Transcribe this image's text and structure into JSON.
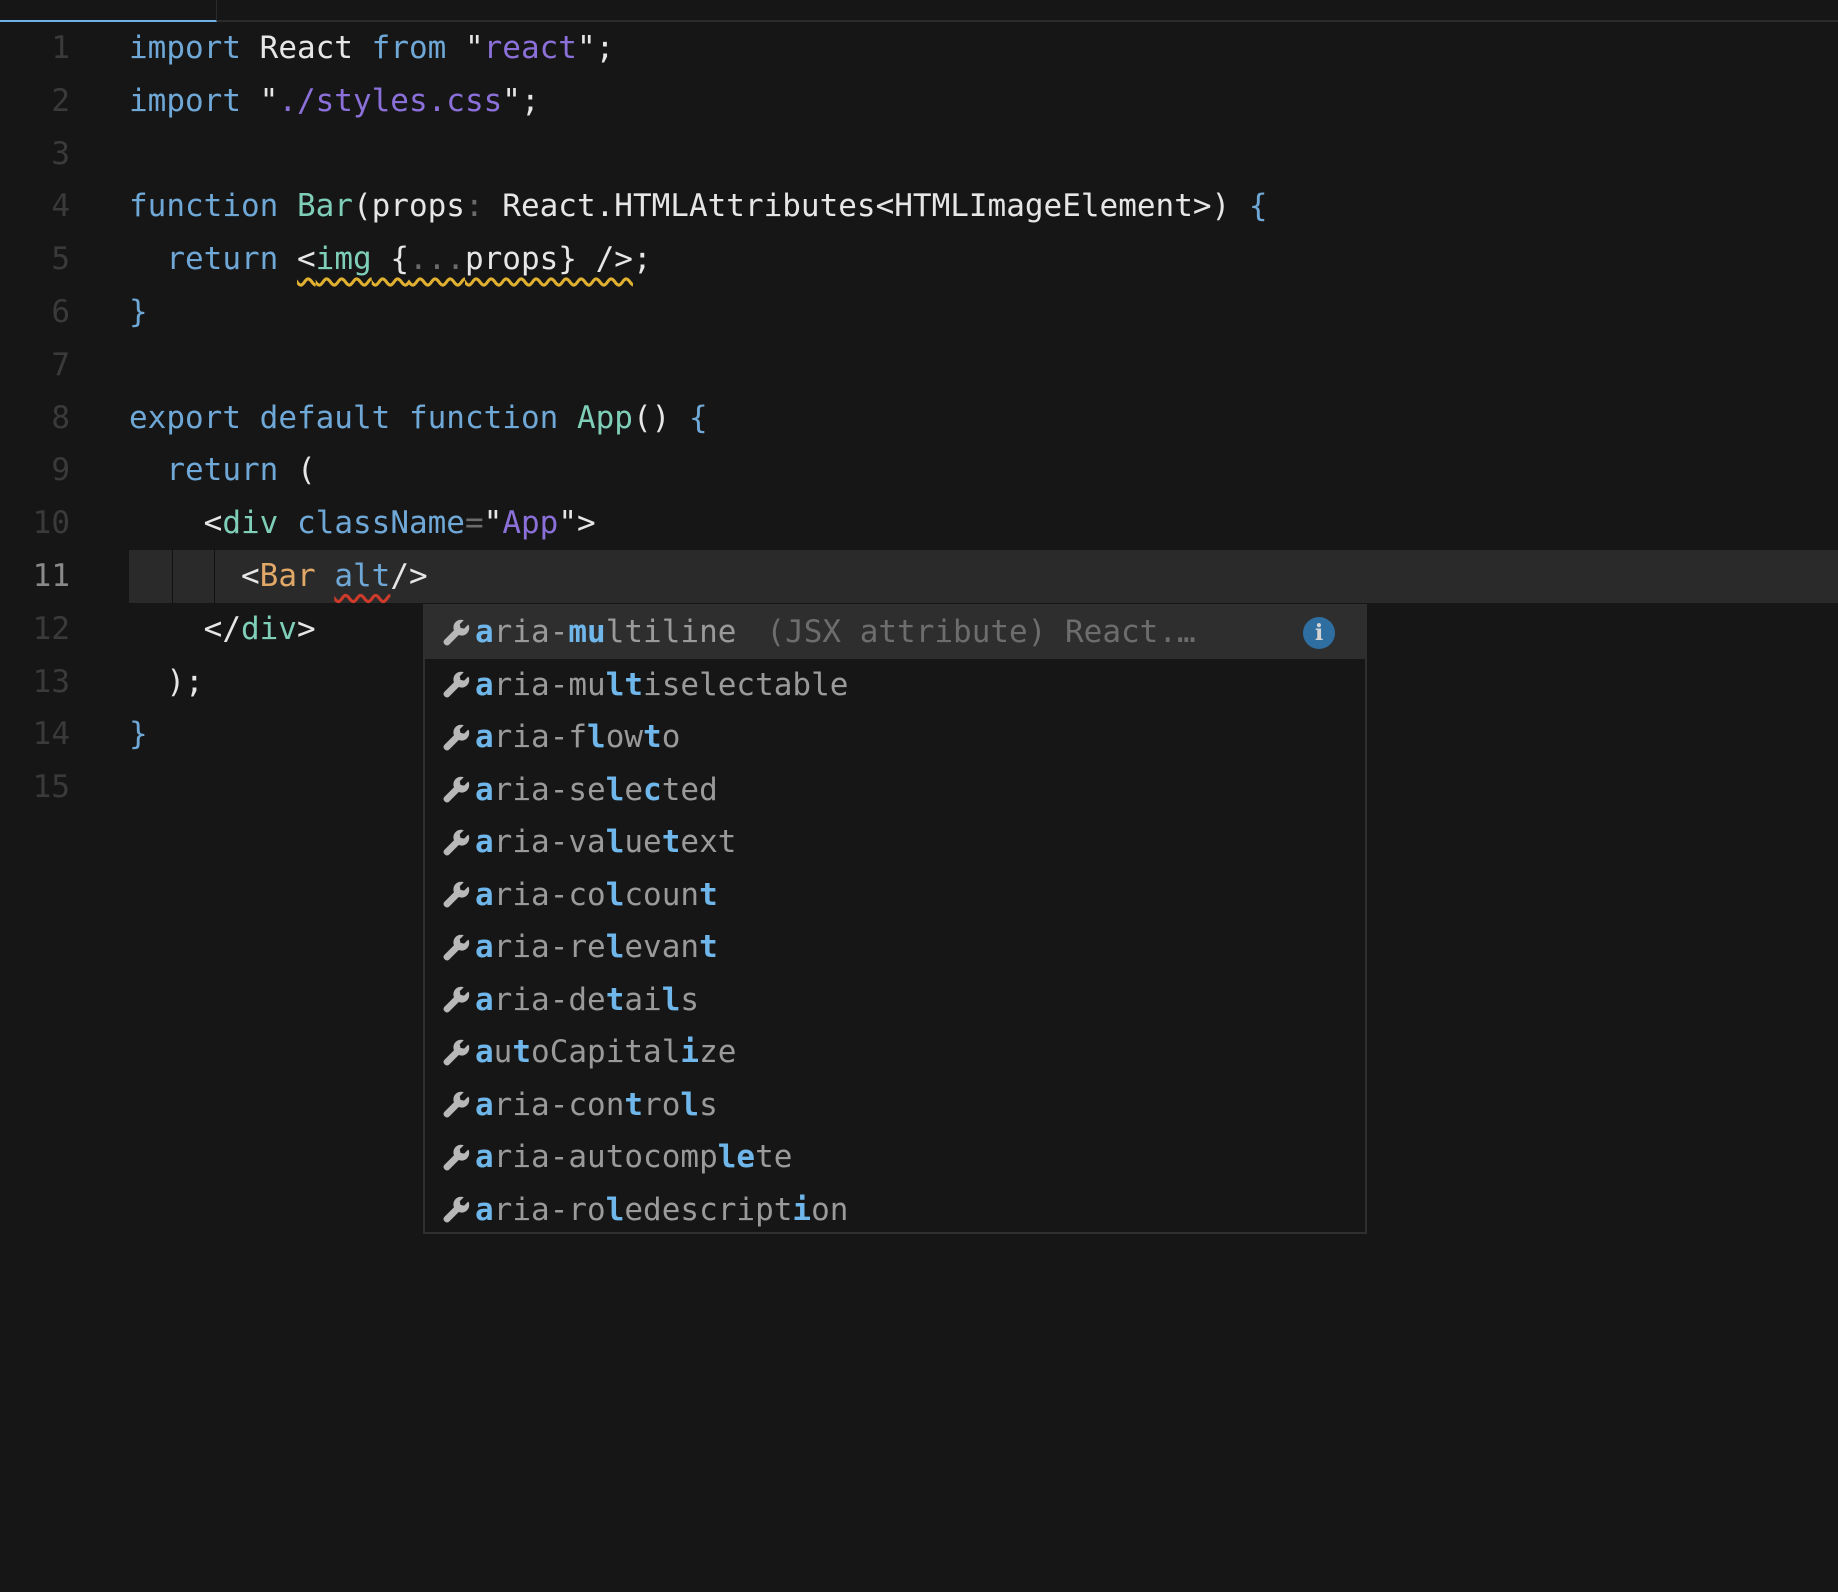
{
  "editor": {
    "language": "tsx",
    "current_line": 11,
    "lines": [
      {
        "n": "1",
        "tokens": [
          [
            "kw",
            "import"
          ],
          [
            "punc",
            " "
          ],
          [
            "punc",
            "React"
          ],
          [
            "punc",
            " "
          ],
          [
            "kw",
            "from"
          ],
          [
            "punc",
            " \""
          ],
          [
            "str",
            "react"
          ],
          [
            "punc",
            "\";"
          ]
        ]
      },
      {
        "n": "2",
        "tokens": [
          [
            "kw",
            "import"
          ],
          [
            "punc",
            " \""
          ],
          [
            "str",
            "./styles.css"
          ],
          [
            "punc",
            "\";"
          ]
        ]
      },
      {
        "n": "3",
        "tokens": []
      },
      {
        "n": "4",
        "tokens": [
          [
            "kw",
            "function"
          ],
          [
            "punc",
            " "
          ],
          [
            "fn",
            "Bar"
          ],
          [
            "punc",
            "(props"
          ],
          [
            "dim",
            ":"
          ],
          [
            "punc",
            " React.HTMLAttributes<HTMLImageElement>) "
          ],
          [
            "brace",
            "{"
          ]
        ]
      },
      {
        "n": "5",
        "tokens": [
          [
            "punc",
            "  "
          ],
          [
            "kw",
            "return"
          ],
          [
            "punc",
            " "
          ],
          [
            "warn",
            "<img {...props} />"
          ],
          [
            "punc",
            ";"
          ]
        ]
      },
      {
        "n": "6",
        "tokens": [
          [
            "brace",
            "}"
          ]
        ]
      },
      {
        "n": "7",
        "tokens": []
      },
      {
        "n": "8",
        "tokens": [
          [
            "kw",
            "export"
          ],
          [
            "punc",
            " "
          ],
          [
            "kw",
            "default"
          ],
          [
            "punc",
            " "
          ],
          [
            "kw",
            "function"
          ],
          [
            "punc",
            " "
          ],
          [
            "fn",
            "App"
          ],
          [
            "punc",
            "() "
          ],
          [
            "brace",
            "{"
          ]
        ]
      },
      {
        "n": "9",
        "tokens": [
          [
            "punc",
            "  "
          ],
          [
            "kw",
            "return"
          ],
          [
            "punc",
            " ("
          ]
        ]
      },
      {
        "n": "10",
        "tokens": [
          [
            "punc",
            "    <"
          ],
          [
            "tag",
            "div"
          ],
          [
            "punc",
            " "
          ],
          [
            "attr",
            "className"
          ],
          [
            "dim",
            "="
          ],
          [
            "punc",
            "\""
          ],
          [
            "str",
            "App"
          ],
          [
            "punc",
            "\">"
          ]
        ]
      },
      {
        "n": "11",
        "tokens": [
          [
            "punc",
            "      <"
          ],
          [
            "comp",
            "Bar"
          ],
          [
            "punc",
            " "
          ],
          [
            "err",
            "alt"
          ],
          [
            "punc",
            "/>"
          ]
        ]
      },
      {
        "n": "12",
        "tokens": [
          [
            "punc",
            "    </"
          ],
          [
            "tag",
            "div"
          ],
          [
            "punc",
            ">"
          ]
        ]
      },
      {
        "n": "13",
        "tokens": [
          [
            "punc",
            "  );"
          ]
        ]
      },
      {
        "n": "14",
        "tokens": [
          [
            "brace",
            "}"
          ]
        ]
      },
      {
        "n": "15",
        "tokens": []
      }
    ]
  },
  "suggest": {
    "icon": "wrench-icon",
    "icon_glyph": "🔧",
    "selected_index": 0,
    "selected_detail": "(JSX attribute) React.…",
    "info_glyph": "i",
    "items": [
      {
        "label": "aria-multiline",
        "match": [
          0,
          5,
          6
        ]
      },
      {
        "label": "aria-multiselectable",
        "match": [
          0,
          7,
          8
        ]
      },
      {
        "label": "aria-flowto",
        "match": [
          0,
          6,
          9
        ]
      },
      {
        "label": "aria-selected",
        "match": [
          0,
          7,
          9
        ]
      },
      {
        "label": "aria-valuetext",
        "match": [
          0,
          7,
          10
        ]
      },
      {
        "label": "aria-colcount",
        "match": [
          0,
          7,
          12
        ]
      },
      {
        "label": "aria-relevant",
        "match": [
          0,
          7,
          12
        ]
      },
      {
        "label": "aria-details",
        "match": [
          0,
          7,
          10
        ]
      },
      {
        "label": "autoCapitalize",
        "match": [
          0,
          2,
          11
        ]
      },
      {
        "label": "aria-controls",
        "match": [
          0,
          8,
          11
        ]
      },
      {
        "label": "aria-autocomplete",
        "match": [
          0,
          13,
          14
        ]
      },
      {
        "label": "aria-roledescription",
        "match": [
          0,
          7,
          17
        ]
      }
    ]
  },
  "colors": {
    "background": "#161616",
    "current_line": "#2a2a2a",
    "match_highlight": "#6fb6ea",
    "tab_active_border": "#6fb3e6",
    "warning_squiggle": "#e0b030",
    "error_squiggle": "#d03a2a",
    "info_icon": "#2f6ea0"
  }
}
